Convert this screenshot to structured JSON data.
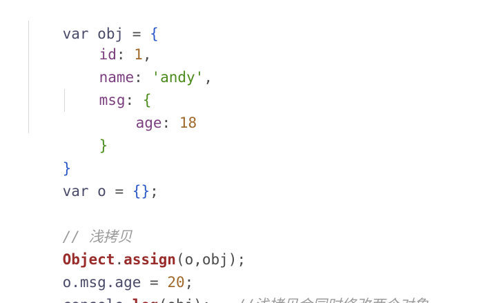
{
  "code": {
    "l1": {
      "kw": "var",
      "name": "obj",
      "op": "=",
      "open": "{"
    },
    "l2": {
      "prop": "id",
      "colon": ":",
      "num": "1",
      "comma": ","
    },
    "l3": {
      "prop": "name",
      "colon": ":",
      "str": "'andy'",
      "comma": ","
    },
    "l4": {
      "prop": "msg",
      "colon": ":",
      "open": "{"
    },
    "l5": {
      "prop": "age",
      "colon": ":",
      "num": "18"
    },
    "l6": {
      "close": "}"
    },
    "l7": {
      "close": "}"
    },
    "l8": {
      "kw": "var",
      "name": "o",
      "op": "=",
      "braces": "{}",
      "semi": ";"
    },
    "l10": {
      "comment": "// 浅拷贝"
    },
    "l11": {
      "cls": "Object",
      "dot": ".",
      "fn": "assign",
      "args": "(o,obj);"
    },
    "l12": {
      "expr": "o.msg.age",
      "op": "=",
      "num": "20",
      "semi": ";"
    },
    "l13": {
      "obj": "console",
      "dot": ".",
      "fn": "log",
      "args": "(obj);",
      "comment": "//浅拷贝会同时修改两个对象"
    }
  },
  "colors": {
    "keyword": "#4a4a6a",
    "property": "#7b3f7f",
    "number": "#a0682a",
    "string": "#4b8a1c",
    "brace": "#2b58c9",
    "comment": "#9a9a9a",
    "function": "#9a2b2b"
  }
}
